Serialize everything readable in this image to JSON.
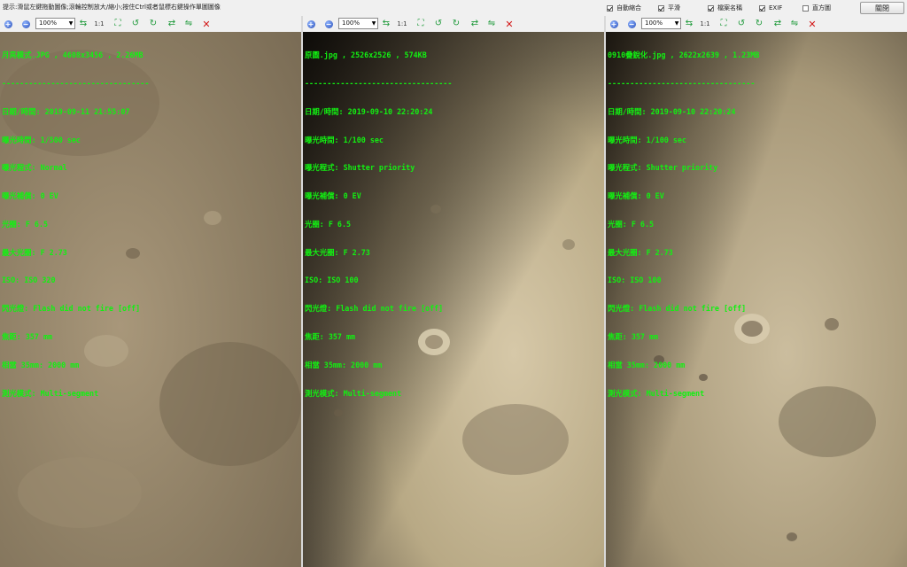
{
  "top_bar": {
    "hint": "提示:滑鼠左鍵拖動圖像;滾輪控制放大/縮小;按住Ctrl或者鼠標右鍵操作單圖圖像",
    "options": [
      {
        "label": "自動縮合",
        "checked": true
      },
      {
        "label": "平滑",
        "checked": true
      },
      {
        "label": "檔案名稱",
        "checked": true
      },
      {
        "label": "EXIF",
        "checked": true
      },
      {
        "label": "直方圖",
        "checked": false
      }
    ],
    "close_label": "關閉"
  },
  "panels": [
    {
      "zoom": "100%",
      "one_to_one": "1:1",
      "filename_line": "月亮模式.JPG , 4608x3456 , 2.26MB",
      "divider": "---------------------------------",
      "exif": [
        "日期/時間: 2019-09-11 21:55:07",
        "曝光時間: 1/500 sec",
        "曝光程式: Normal",
        "曝光補償: 0 EV",
        "光圈: F 6.5",
        "最大光圈: F 2.73",
        "ISO: ISO 320",
        "閃光燈: Flash did not fire [off]",
        "焦距: 357 mm",
        "相當 35mm: 2000 mm",
        "測光模式: Multi-segment"
      ]
    },
    {
      "zoom": "100%",
      "one_to_one": "1:1",
      "filename_line": "原圖.jpg , 2526x2526 , 574KB",
      "divider": "---------------------------------",
      "exif": [
        "日期/時間: 2019-09-10 22:20:24",
        "曝光時間: 1/100 sec",
        "曝光程式: Shutter priority",
        "曝光補償: 0 EV",
        "光圈: F 6.5",
        "最大光圈: F 2.73",
        "ISO: ISO 100",
        "閃光燈: Flash did not fire [off]",
        "焦距: 357 mm",
        "相當 35mm: 2000 mm",
        "測光模式: Multi-segment"
      ]
    },
    {
      "zoom": "100%",
      "one_to_one": "1:1",
      "filename_line": "0910疊銳化.jpg , 2622x2639 , 1.23MB",
      "divider": "---------------------------------",
      "exif": [
        "日期/時間: 2019-09-10 22:20:24",
        "曝光時間: 1/100 sec",
        "曝光程式: Shutter priority",
        "曝光補償: 0 EV",
        "光圈: F 6.5",
        "最大光圈: F 2.73",
        "ISO: ISO 100",
        "閃光燈: Flash did not fire [off]",
        "焦距: 357 mm",
        "相當 35mm: 2000 mm",
        "測光模式: Multi-segment"
      ]
    }
  ],
  "colors": {
    "overlay_text": "#12f012",
    "panel_bg": "#f0f0f0",
    "close_x": "#d31818"
  }
}
